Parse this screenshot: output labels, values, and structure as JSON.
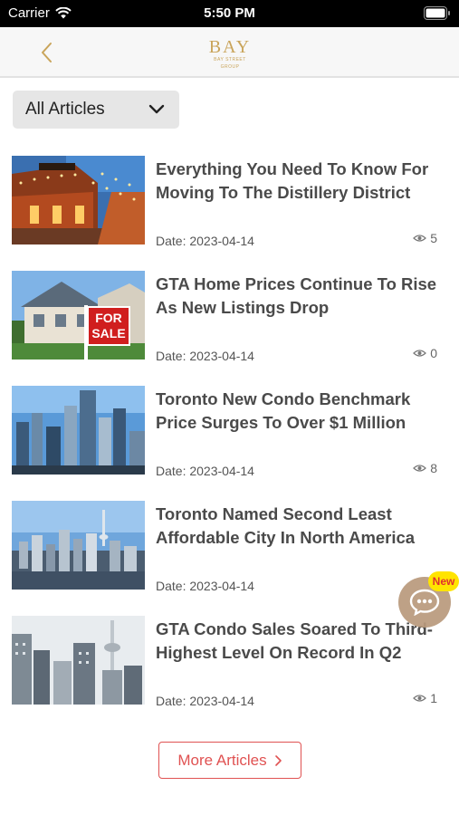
{
  "status_bar": {
    "carrier": "Carrier",
    "time": "5:50 PM"
  },
  "header": {
    "logo_text": "BAY",
    "logo_subtext": "BAY STREET GROUP"
  },
  "filter": {
    "selected": "All Articles"
  },
  "articles": [
    {
      "title": "Everything You Need To Know For Moving To The Distillery District",
      "date": "Date: 2023-04-14",
      "views": "5",
      "image": "distillery-lights"
    },
    {
      "title": "GTA Home Prices Continue To Rise As New Listings Drop",
      "date": "Date: 2023-04-14",
      "views": "0",
      "image": "house-for-sale",
      "sign_line1": "FOR",
      "sign_line2": "SALE"
    },
    {
      "title": "Toronto New Condo Benchmark Price Surges To Over $1 Million",
      "date": "Date: 2023-04-14",
      "views": "8",
      "image": "condo-towers"
    },
    {
      "title": "Toronto Named Second Least Affordable City In North America",
      "date": "Date: 2023-04-14",
      "views": "",
      "image": "toronto-skyline"
    },
    {
      "title": "GTA Condo Sales Soared To Third-Highest Level On Record In Q2",
      "date": "Date: 2023-04-14",
      "views": "1",
      "image": "cn-tower-condos"
    }
  ],
  "more_button": {
    "label": "More Articles"
  },
  "chat": {
    "badge": "New"
  },
  "colors": {
    "accent": "#e05252",
    "gold": "#c9a45a",
    "title": "#4a4a4a"
  }
}
